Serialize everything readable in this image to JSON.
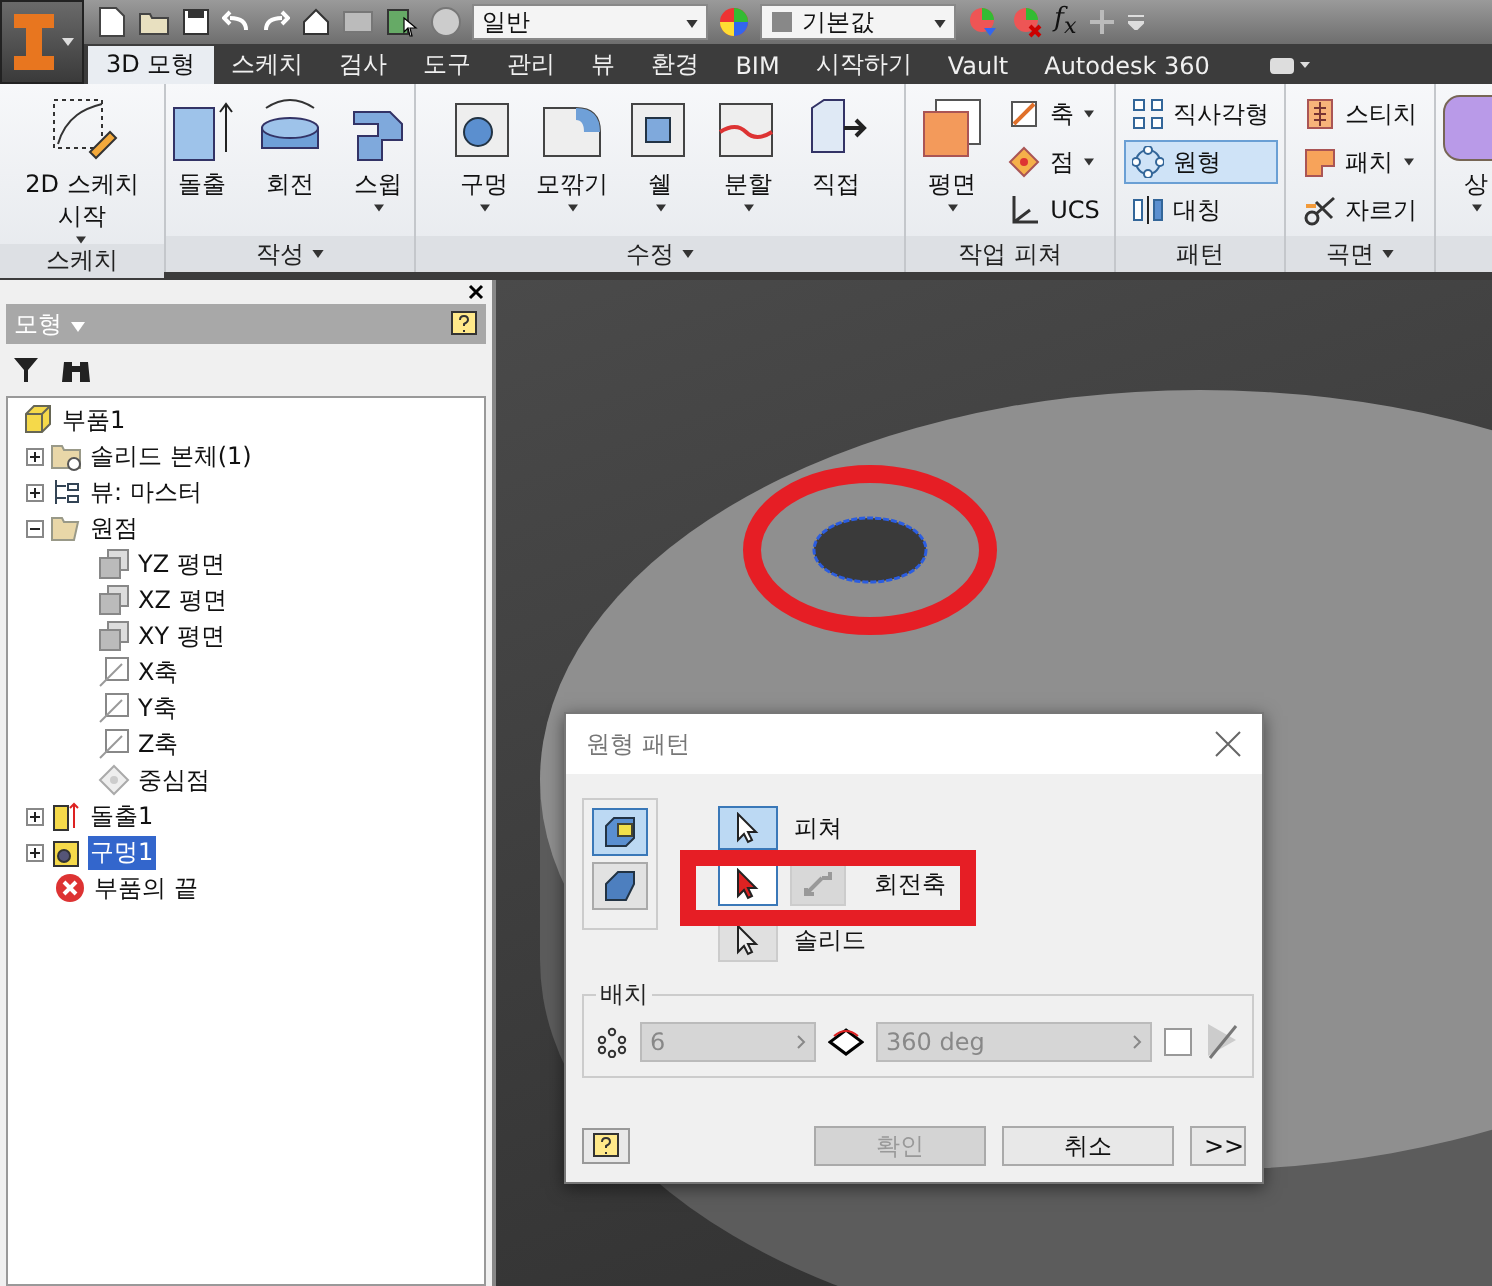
{
  "quick_access": {
    "style": "일반",
    "material": "기본값",
    "formula": "f$_{x}$"
  },
  "tabs": [
    {
      "label": "3D 모형",
      "selected": true
    },
    {
      "label": "스케치",
      "selected": false
    },
    {
      "label": "검사",
      "selected": false
    },
    {
      "label": "도구",
      "selected": false
    },
    {
      "label": "관리",
      "selected": false
    },
    {
      "label": "뷰",
      "selected": false
    },
    {
      "label": "환경",
      "selected": false
    },
    {
      "label": "BIM",
      "selected": false
    },
    {
      "label": "시작하기",
      "selected": false
    },
    {
      "label": "Vault",
      "selected": false
    },
    {
      "label": "Autodesk 360",
      "selected": false
    }
  ],
  "ribbon": {
    "panels": [
      {
        "label": "스케치",
        "menu": false,
        "tools": [
          {
            "kind": "large",
            "label": "2D 스케치\n시작",
            "dropdown": true
          }
        ]
      },
      {
        "label": "작성",
        "menu": true,
        "tools": [
          {
            "kind": "large",
            "label": "돌출",
            "dropdown": false
          },
          {
            "kind": "large",
            "label": "회전",
            "dropdown": false
          },
          {
            "kind": "large",
            "label": "스윕",
            "dropdown": true
          }
        ]
      },
      {
        "label": "수정",
        "menu": true,
        "tools": [
          {
            "kind": "large",
            "label": "구멍",
            "dropdown": true
          },
          {
            "kind": "large",
            "label": "모깎기",
            "dropdown": true
          },
          {
            "kind": "large",
            "label": "쉘",
            "dropdown": true
          },
          {
            "kind": "large",
            "label": "분할",
            "dropdown": true
          },
          {
            "kind": "large",
            "label": "직접",
            "dropdown": false
          }
        ]
      },
      {
        "label": "작업 피쳐",
        "menu": false,
        "tools": [
          {
            "kind": "large",
            "label": "평면",
            "dropdown": true
          },
          {
            "kind": "small",
            "label": "축",
            "dropdown": true
          },
          {
            "kind": "small",
            "label": "점",
            "dropdown": true
          },
          {
            "kind": "small",
            "label": "UCS",
            "dropdown": false
          }
        ]
      },
      {
        "label": "패턴",
        "menu": false,
        "tools": [
          {
            "kind": "small",
            "label": "직사각형",
            "dropdown": false,
            "active": false
          },
          {
            "kind": "small",
            "label": "원형",
            "dropdown": false,
            "active": true
          },
          {
            "kind": "small",
            "label": "대칭",
            "dropdown": false,
            "active": false
          }
        ]
      },
      {
        "label": "곡면",
        "menu": true,
        "tools": [
          {
            "kind": "small",
            "label": "스티치",
            "dropdown": false
          },
          {
            "kind": "small",
            "label": "패치",
            "dropdown": true
          },
          {
            "kind": "small",
            "label": "자르기",
            "dropdown": false
          }
        ]
      },
      {
        "menu": false,
        "tools": [
          {
            "kind": "large",
            "label": "상",
            "dropdown": true
          }
        ]
      }
    ]
  },
  "browser": {
    "title": "모형",
    "tree": [
      {
        "label": "부품1",
        "selected": false,
        "children": [
          {
            "label": "솔리드 본체(1)",
            "expanded": false,
            "selected": false
          },
          {
            "label": "뷰: 마스터",
            "expanded": false,
            "selected": false
          },
          {
            "label": "원점",
            "expanded": true,
            "selected": false,
            "children": [
              {
                "label": "YZ 평면",
                "selected": false
              },
              {
                "label": "XZ 평면",
                "selected": false
              },
              {
                "label": "XY 평면",
                "selected": false
              },
              {
                "label": "X축",
                "selected": false
              },
              {
                "label": "Y축",
                "selected": false
              },
              {
                "label": "Z축",
                "selected": false
              },
              {
                "label": "중심점",
                "selected": false
              }
            ]
          },
          {
            "label": "돌출1",
            "expanded": false,
            "selected": false
          },
          {
            "label": "구멍1",
            "expanded": false,
            "selected": true
          },
          {
            "label": "부품의 끝",
            "selected": false
          }
        ]
      }
    ]
  },
  "dialog": {
    "title": "원형 패턴",
    "modes": [
      {
        "selected": true
      },
      {
        "selected": false
      }
    ],
    "selectors": [
      {
        "kind": "select",
        "label": "피쳐",
        "selected": false,
        "disabled": false
      },
      {
        "kind": "axis",
        "label": "회전축",
        "selected": true,
        "disabled": false
      },
      {
        "kind": "select",
        "label": "솔리드",
        "selected": false,
        "disabled": true
      }
    ],
    "placement": {
      "title": "배치",
      "count": "6",
      "angle": "360 deg",
      "fitted": false
    },
    "buttons": [
      {
        "label": "확인",
        "disabled": true
      },
      {
        "label": "취소",
        "disabled": false
      }
    ],
    "more": ">>"
  }
}
